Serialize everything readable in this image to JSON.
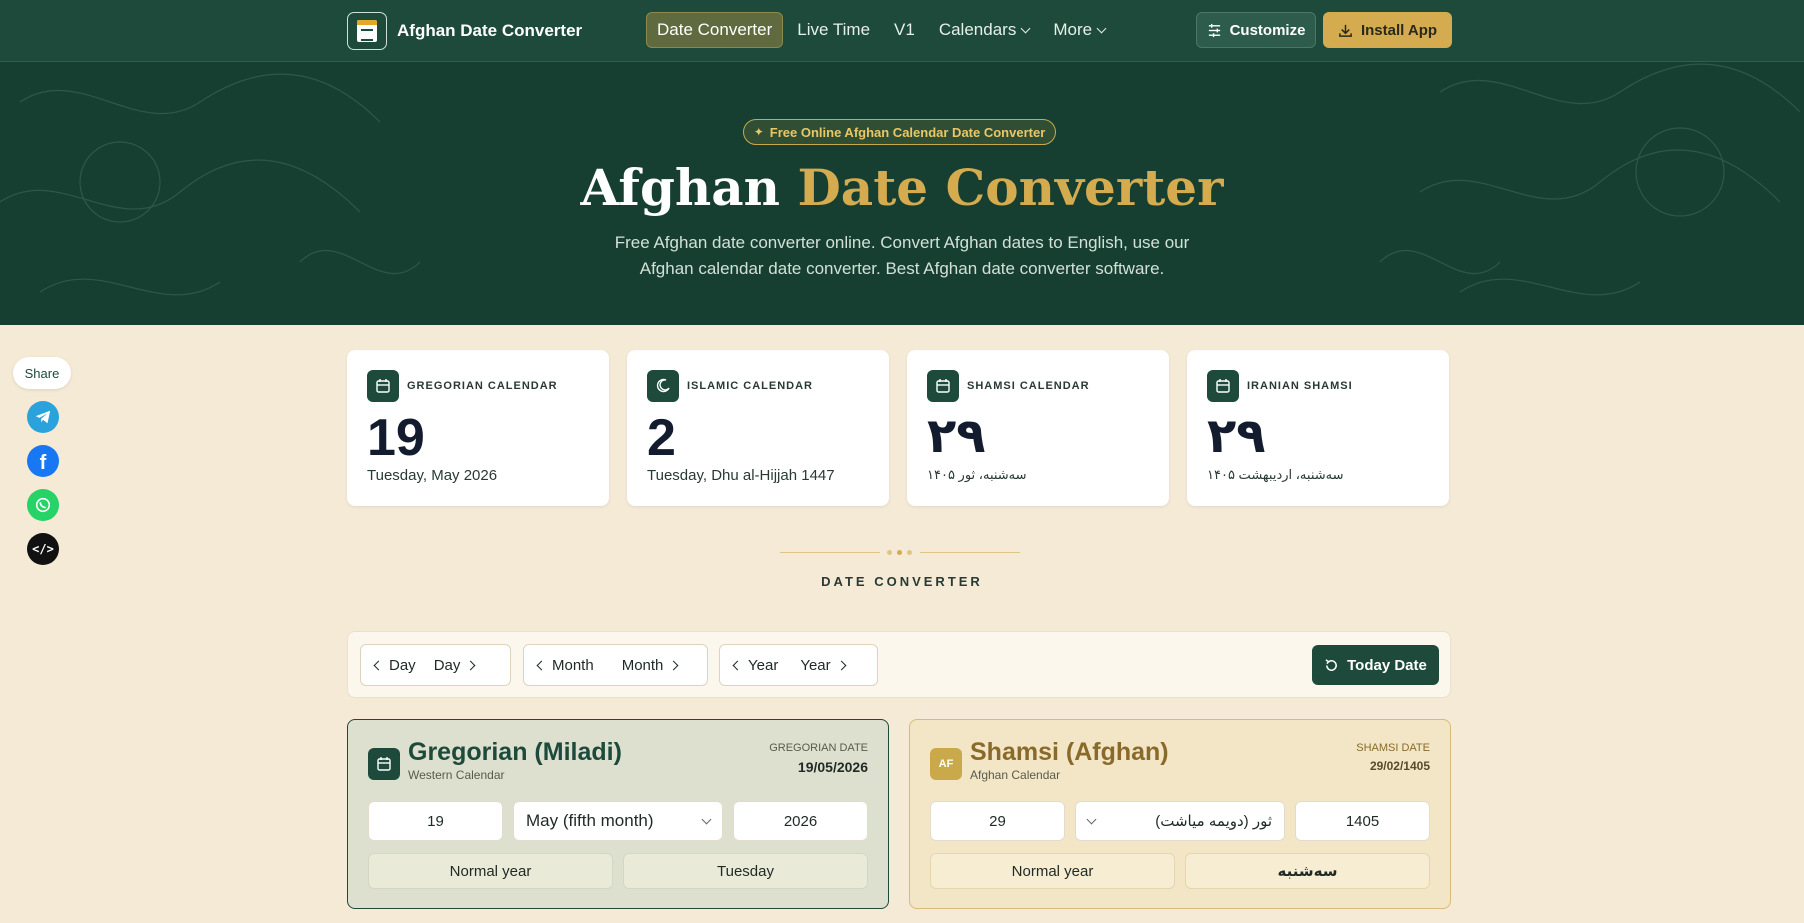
{
  "nav": {
    "brand": "Afghan Date Converter",
    "links": [
      {
        "label": "Date Converter"
      },
      {
        "label": "Live Time"
      },
      {
        "label": "V1"
      },
      {
        "label": "Calendars"
      },
      {
        "label": "More"
      }
    ],
    "customize": "Customize",
    "install": "Install App"
  },
  "hero": {
    "badge": "Free Online Afghan Calendar Date Converter",
    "title_main": "Afghan",
    "title_accent": "Date Converter",
    "description": "Free Afghan date converter online. Convert Afghan dates to English, use our Afghan calendar date converter. Best Afghan date converter software."
  },
  "share": {
    "label": "Share",
    "icons": [
      "telegram-icon",
      "facebook-icon",
      "whatsapp-icon",
      "embed-code-icon"
    ]
  },
  "cards": [
    {
      "label": "GREGORIAN CALENDAR",
      "number": "19",
      "sub": "Tuesday, May 2026",
      "icon": "calendar-icon"
    },
    {
      "label": "ISLAMIC CALENDAR",
      "number": "2",
      "sub": "Tuesday, Dhu al-Hijjah 1447",
      "icon": "moon-icon"
    },
    {
      "label": "SHAMSI CALENDAR",
      "number": "۲۹",
      "sub": "سه‌شنبه، ثور ۱۴۰۵",
      "icon": "calendar-icon"
    },
    {
      "label": "IRANIAN SHAMSI",
      "number": "۲۹",
      "sub": "سه‌شنبه، اردیبهشت ۱۴۰۵",
      "icon": "calendar-icon"
    }
  ],
  "converter": {
    "section_label": "DATE CONVERTER",
    "controls": {
      "day_prev": "Day",
      "day_next": "Day",
      "month_prev": "Month",
      "month_next": "Month",
      "year_prev": "Year",
      "year_next": "Year",
      "today": "Today Date"
    },
    "gregorian": {
      "title": "Gregorian (Miladi)",
      "subtitle": "Western Calendar",
      "date_label": "GREGORIAN DATE",
      "date": "19/05/2026",
      "day": "19",
      "month": "May (fifth month)",
      "year": "2026",
      "year_type": "Normal year",
      "weekday": "Tuesday"
    },
    "shamsi": {
      "title": "Shamsi (Afghan)",
      "subtitle": "Afghan Calendar",
      "badge": "AF",
      "date_label": "SHAMSI DATE",
      "date": "29/02/1405",
      "day": "29",
      "month": "ثور (دویمه میاشت)",
      "year": "1405",
      "year_type": "Normal year",
      "weekday": "سه‌شنبه"
    }
  },
  "colors": {
    "primary": "#1d4a3a",
    "accent": "#d4ab4f",
    "background": "#f4ead6"
  }
}
